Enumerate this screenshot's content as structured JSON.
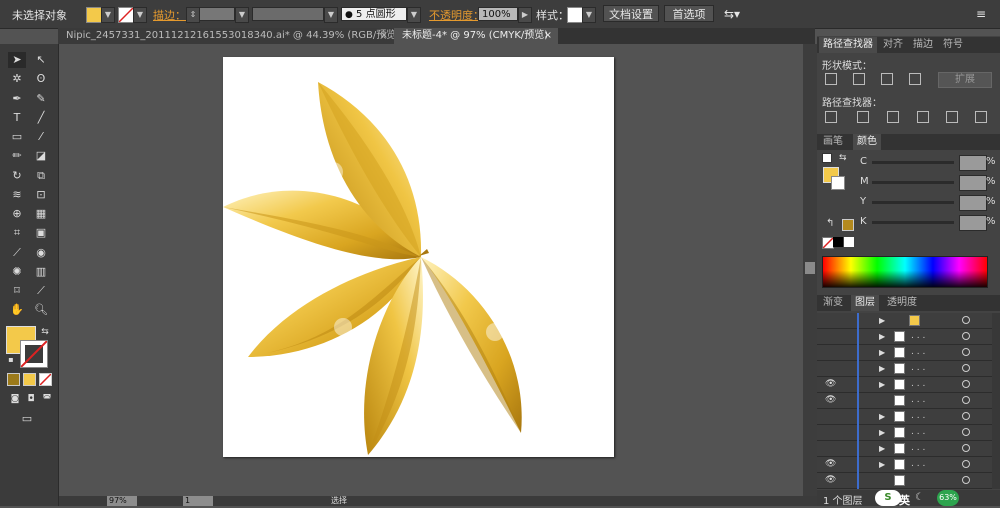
{
  "control_bar": {
    "selection_label": "未选择对象",
    "stroke_label": "描边：",
    "brush_label": "5 点圆形",
    "opacity_label": "不透明度：",
    "opacity_value": "100%",
    "style_label": "样式：",
    "doc_setup_label": "文档设置",
    "preferences_label": "首选项",
    "fill_color": "#f3c94a"
  },
  "tabs": [
    {
      "label": "Nipic_2457331_20111212161553018340.ai* @ 44.39% (RGB/预览)",
      "close": "×"
    },
    {
      "label": "未标题-4* @ 97% (CMYK/预览)",
      "close": "×"
    }
  ],
  "status": {
    "zoom": "97%",
    "page": "1",
    "tool": "选择"
  },
  "pathfinder": {
    "tabs": [
      "路径查找器",
      "对齐",
      "描边",
      "符号"
    ],
    "shape_modes_label": "形状模式：",
    "expand_label": "扩展",
    "pathfinders_label": "路径查找器："
  },
  "color_panel": {
    "tabs": [
      "画笔",
      "颜色"
    ],
    "channels": [
      "C",
      "M",
      "Y",
      "K"
    ],
    "percent": "%",
    "accent": "#b48a1e"
  },
  "layers_panel": {
    "tabs": [
      "渐变",
      "图层",
      "透明度"
    ],
    "footer": "1 个图层",
    "row_dots": ". . ."
  },
  "tray": {
    "ime": "英",
    "battery": "63%"
  }
}
